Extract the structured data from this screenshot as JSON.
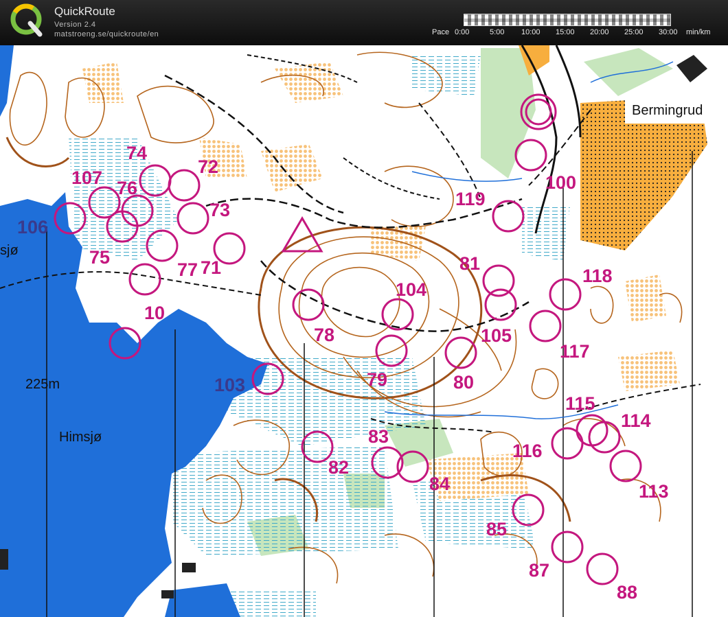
{
  "header": {
    "app_title": "QuickRoute",
    "version": "Version 2.4",
    "url": "matstroeng.se/quickroute/en",
    "pace_label": "Pace",
    "pace_ticks": [
      "0:00",
      "5:00",
      "10:00",
      "15:00",
      "20:00",
      "25:00",
      "30:00"
    ],
    "pace_unit": "min/km"
  },
  "map": {
    "place_names": {
      "bermingrud": "Bermingrud",
      "himsjo": "Himsjø",
      "sjo_fragment": "sjø"
    },
    "spot_height": "225m",
    "controls": [
      "71",
      "72",
      "73",
      "74",
      "75",
      "76",
      "77",
      "10",
      "78",
      "79",
      "80",
      "81",
      "82",
      "83",
      "84",
      "85",
      "87",
      "88",
      "100",
      "103",
      "104",
      "105",
      "106",
      "107",
      "113",
      "114",
      "115",
      "116",
      "117",
      "118",
      "119"
    ],
    "colors": {
      "water": "#1f6fd9",
      "open_land": "#f7ae3e",
      "contour": "#b5651d",
      "course": "#c4177e",
      "green": "#bfe3b5",
      "marsh": "#3fa9c9"
    }
  }
}
